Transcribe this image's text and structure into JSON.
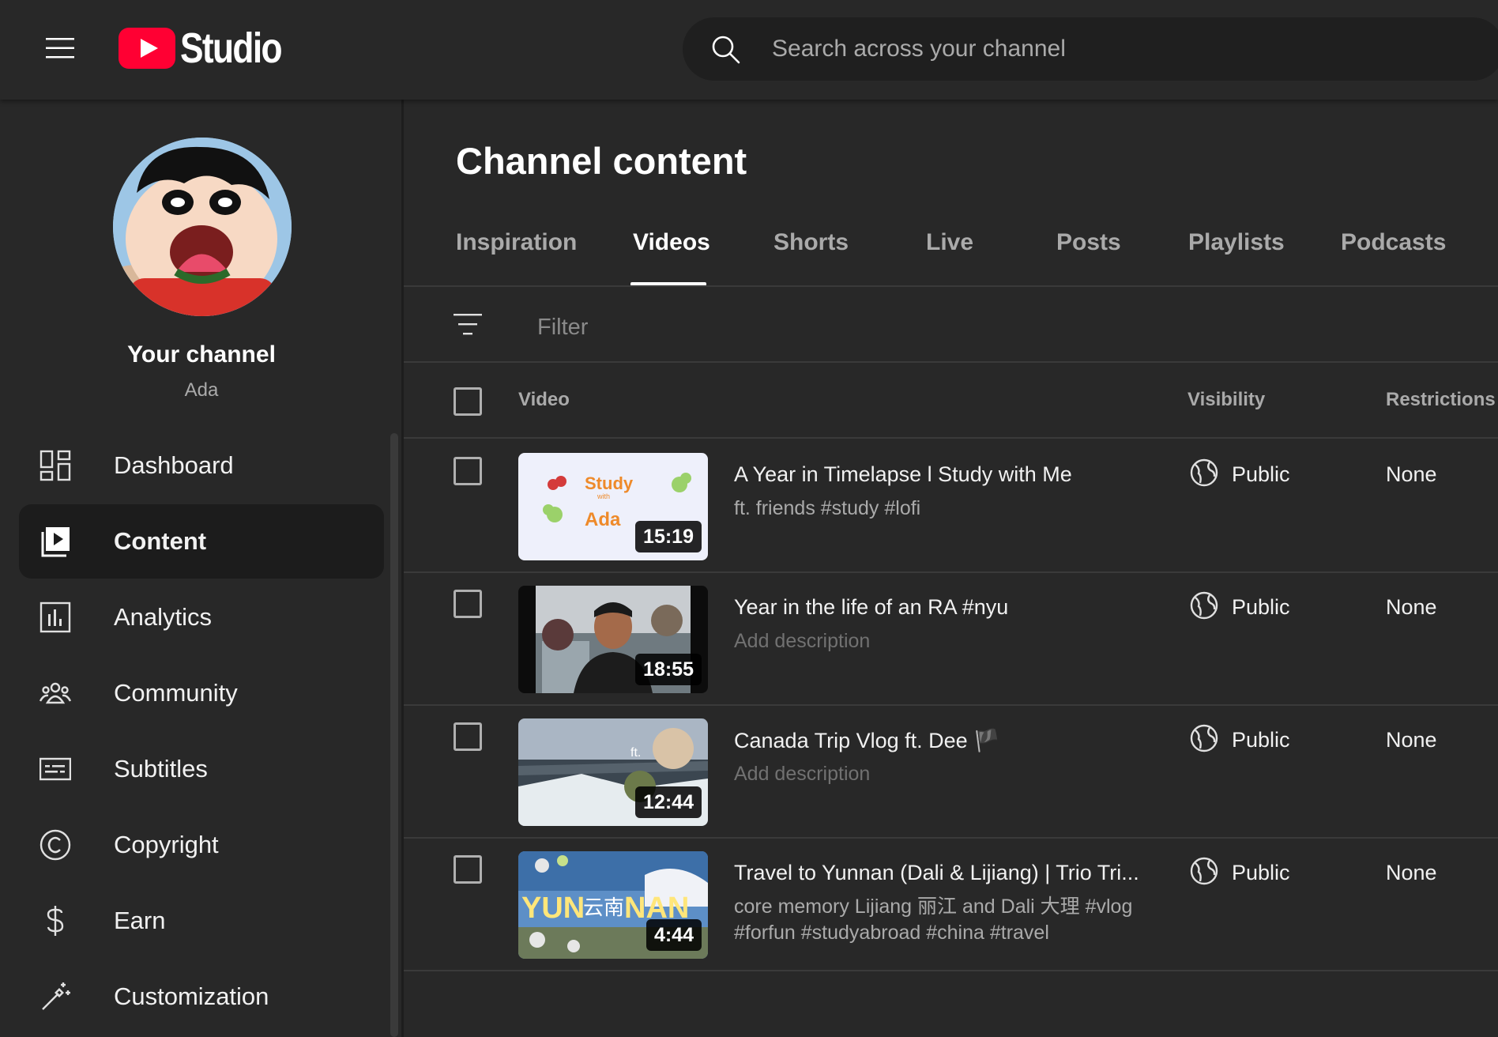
{
  "app": {
    "brand": "Studio",
    "search_placeholder": "Search across your channel"
  },
  "sidebar": {
    "channel_title": "Your channel",
    "channel_handle": "Ada",
    "items": [
      {
        "label": "Dashboard",
        "icon": "dashboard-icon",
        "active": false
      },
      {
        "label": "Content",
        "icon": "content-icon",
        "active": true
      },
      {
        "label": "Analytics",
        "icon": "analytics-icon",
        "active": false
      },
      {
        "label": "Community",
        "icon": "community-icon",
        "active": false
      },
      {
        "label": "Subtitles",
        "icon": "subtitles-icon",
        "active": false
      },
      {
        "label": "Copyright",
        "icon": "copyright-icon",
        "active": false
      },
      {
        "label": "Earn",
        "icon": "earn-icon",
        "active": false
      },
      {
        "label": "Customization",
        "icon": "customization-icon",
        "active": false
      }
    ]
  },
  "main": {
    "title": "Channel content",
    "tabs": [
      {
        "label": "Inspiration",
        "active": false
      },
      {
        "label": "Videos",
        "active": true
      },
      {
        "label": "Shorts",
        "active": false
      },
      {
        "label": "Live",
        "active": false
      },
      {
        "label": "Posts",
        "active": false
      },
      {
        "label": "Playlists",
        "active": false
      },
      {
        "label": "Podcasts",
        "active": false
      }
    ],
    "filter_placeholder": "Filter",
    "columns": {
      "video": "Video",
      "visibility": "Visibility",
      "restrictions": "Restrictions"
    },
    "videos": [
      {
        "title": "A Year in Timelapse l Study with Me",
        "description": "ft. friends #study #lofi",
        "description_is_placeholder": false,
        "duration": "15:19",
        "visibility": "Public",
        "restrictions": "None",
        "thumb_text": {
          "line1": "Study",
          "line2": "with",
          "line3": "Ada"
        }
      },
      {
        "title": "Year in the life of an RA #nyu",
        "description": "Add description",
        "description_is_placeholder": true,
        "duration": "18:55",
        "visibility": "Public",
        "restrictions": "None"
      },
      {
        "title": "Canada Trip Vlog ft. Dee 🏴",
        "description": "Add description",
        "description_is_placeholder": true,
        "duration": "12:44",
        "visibility": "Public",
        "restrictions": "None",
        "thumb_text": {
          "line1": "ft."
        }
      },
      {
        "title": "Travel to Yunnan (Dali & Lijiang) | Trio Tri...",
        "description": "core memory Lijiang 丽江 and Dali 大理 #vlog #forfun #studyabroad #china #travel",
        "description_is_placeholder": false,
        "duration": "4:44",
        "visibility": "Public",
        "restrictions": "None",
        "thumb_text": {
          "line1": "YUN",
          "line2": "云南",
          "line3": "NAN"
        }
      }
    ]
  },
  "colors": {
    "background": "#282828",
    "brand_red": "#ff0033",
    "text_primary": "#f1f1f1",
    "text_secondary": "#aaaaaa"
  }
}
